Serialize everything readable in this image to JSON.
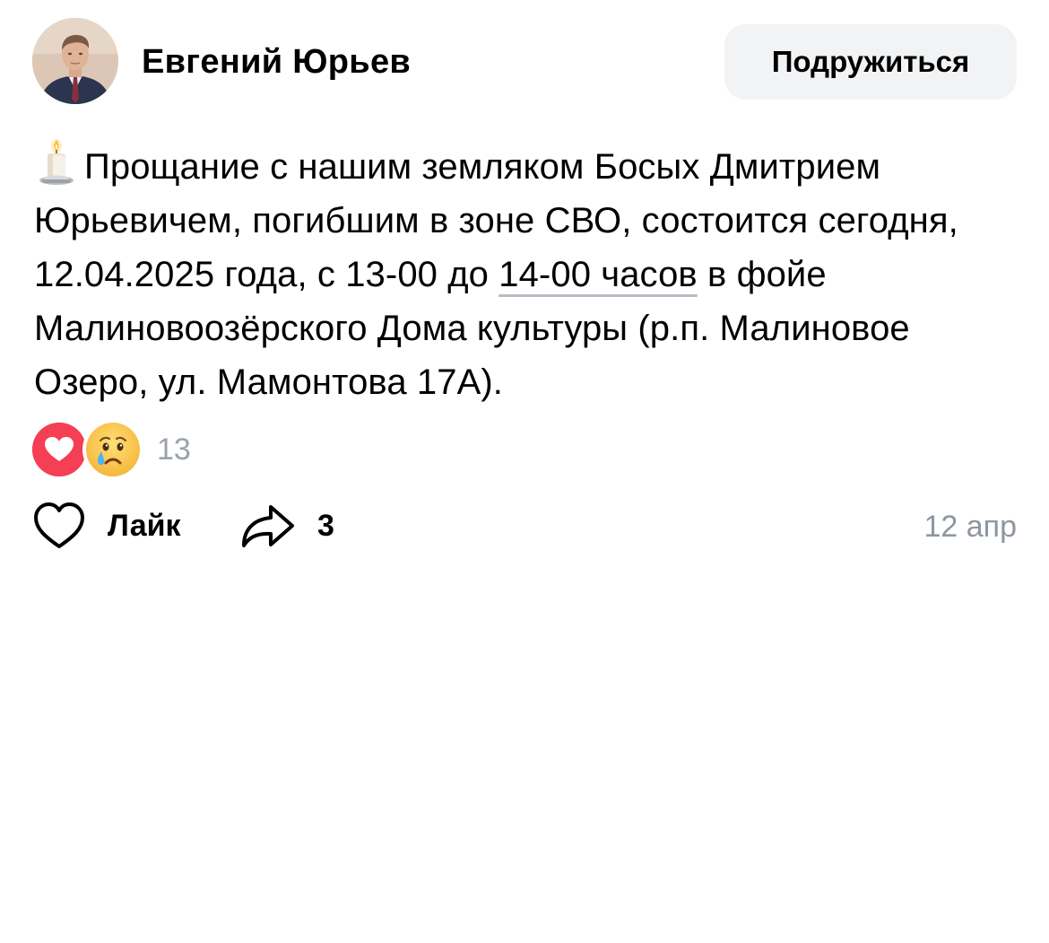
{
  "post": {
    "author": {
      "name": "Евгений Юрьев",
      "avatar_icon": "author-avatar"
    },
    "add_friend_label": "Подружиться",
    "text": {
      "emoji_icon": "candle-icon",
      "part1": "Прощание с нашим земляком Босых Дмитрием Юрьевичем, погибшим в зоне СВО, состоится сегодня, 12.04.2025 года, с 13-00 до ",
      "link": "14-00 часов",
      "part2": " в фойе Малиновоозёрского Дома культуры (р.п. Малиновое Озеро, ул. Мамонтова 17А)."
    },
    "reactions": {
      "icons": [
        "heart-reaction-icon",
        "crying-face-reaction-icon"
      ],
      "count": "13"
    },
    "actions": {
      "like_label": "Лайк",
      "share_count": "3"
    },
    "date": "12 апр"
  },
  "colors": {
    "button_bg": "#f2f3f5",
    "reaction_heart": "#f43f54",
    "muted_text": "#99a2ad",
    "date_text": "#8e96a1"
  }
}
